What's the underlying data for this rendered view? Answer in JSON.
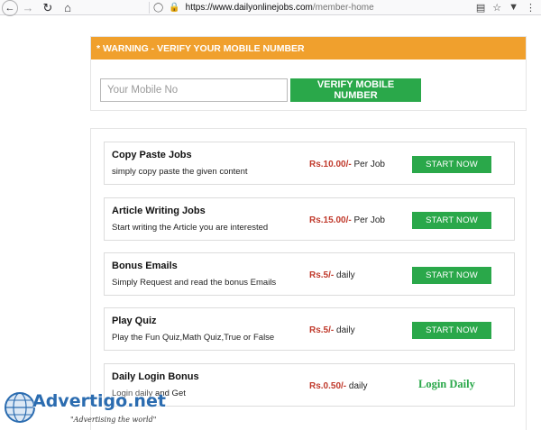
{
  "browser": {
    "url_host": "https://www.dailyonlinejobs.com",
    "url_path": "/member-home"
  },
  "warning": {
    "title": "* WARNING - VERIFY YOUR MOBILE NUMBER",
    "input_placeholder": "Your Mobile No",
    "verify_label": "VERIFY MOBILE NUMBER"
  },
  "jobs": [
    {
      "title": "Copy Paste Jobs",
      "desc": "simply copy paste the given content",
      "price": "Rs.10.00/-",
      "unit": " Per Job",
      "action": "START NOW"
    },
    {
      "title": "Article Writing Jobs",
      "desc": "Start writing the Article you are interested",
      "price": "Rs.15.00/-",
      "unit": " Per Job",
      "action": "START NOW"
    },
    {
      "title": "Bonus Emails",
      "desc": "Simply Request and read the bonus Emails",
      "price": "Rs.5/-",
      "unit": " daily",
      "action": "START NOW"
    },
    {
      "title": "Play Quiz",
      "desc": "Play the Fun Quiz,Math Quiz,True or False",
      "price": "Rs.5/-",
      "unit": " daily",
      "action": "START NOW"
    },
    {
      "title": "Daily Login Bonus",
      "desc_a": "Login daily",
      "desc_b": " and Get",
      "price": "Rs.0.50/-",
      "unit": " daily",
      "action": "Login Daily"
    }
  ],
  "watermark": {
    "brand": "Advertigo.net",
    "tagline": "\"Advertising  the world\""
  },
  "colors": {
    "warning_bar": "#f0a02d",
    "button_green": "#2aa84a",
    "price_red": "#c0392b"
  }
}
